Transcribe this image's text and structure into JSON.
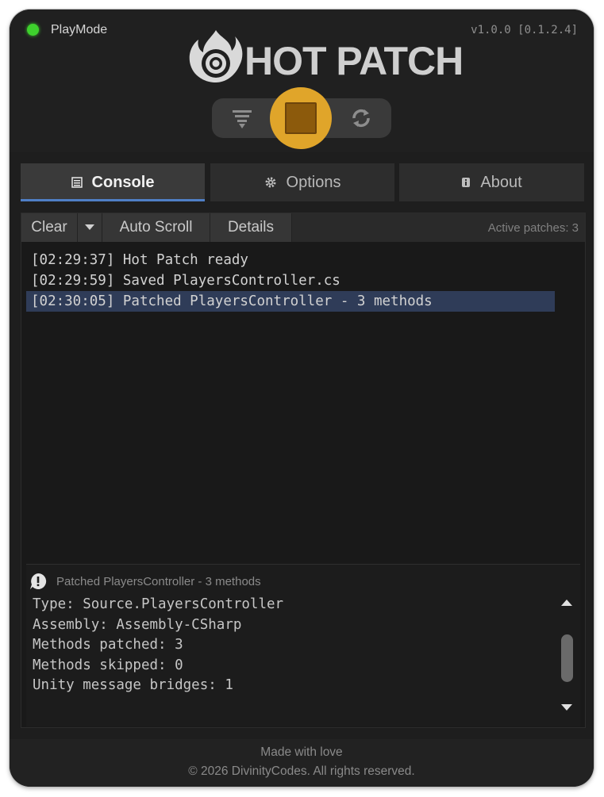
{
  "header": {
    "mode_label": "PlayMode",
    "version": "v1.0.0 [0.1.2.4]",
    "app_title": "HOT PATCH",
    "status_color": "#3ed12d"
  },
  "controls": {
    "filter_icon": "filter-icon",
    "stop_icon": "stop-icon",
    "refresh_icon": "refresh-icon",
    "stop_accent": "#e0a52a"
  },
  "tabs": [
    {
      "label": "Console",
      "icon": "console-icon",
      "active": true
    },
    {
      "label": "Options",
      "icon": "gear-icon",
      "active": false
    },
    {
      "label": "About",
      "icon": "info-icon",
      "active": false
    }
  ],
  "toolbar": {
    "clear_label": "Clear",
    "autoscroll_label": "Auto Scroll",
    "details_label": "Details",
    "active_patches": "Active patches: 3"
  },
  "log": [
    "[02:29:37] Hot Patch ready",
    "[02:29:59] Saved PlayersController.cs",
    "[02:30:05] Patched PlayersController - 3 methods"
  ],
  "details": {
    "title": "Patched PlayersController - 3 methods",
    "lines": [
      "Type: Source.PlayersController",
      "Assembly: Assembly-CSharp",
      "Methods patched: 3",
      "Methods skipped: 0",
      "Unity message bridges: 1"
    ]
  },
  "footer": {
    "line1": "Made with love",
    "line2": "© 2026 DivinityCodes. All rights reserved."
  }
}
